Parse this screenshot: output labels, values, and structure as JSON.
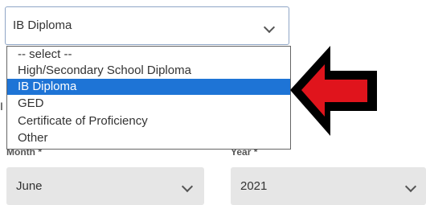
{
  "education_select": {
    "value": "IB Diploma",
    "options": [
      "-- select --",
      "High/Secondary School Diploma",
      "IB Diploma",
      "GED",
      "Certificate of Proficiency",
      "Other"
    ],
    "selected_index": 2
  },
  "hidden_label_peek": "I",
  "month": {
    "label": "Month",
    "required_mark": "*",
    "value": "June"
  },
  "year": {
    "label": "Year",
    "required_mark": "*",
    "value": "2021"
  },
  "colors": {
    "highlight": "#1e74d6",
    "arrow_fill": "#e0141c",
    "arrow_outline": "#000000",
    "field_bg": "#e6e6e6"
  }
}
